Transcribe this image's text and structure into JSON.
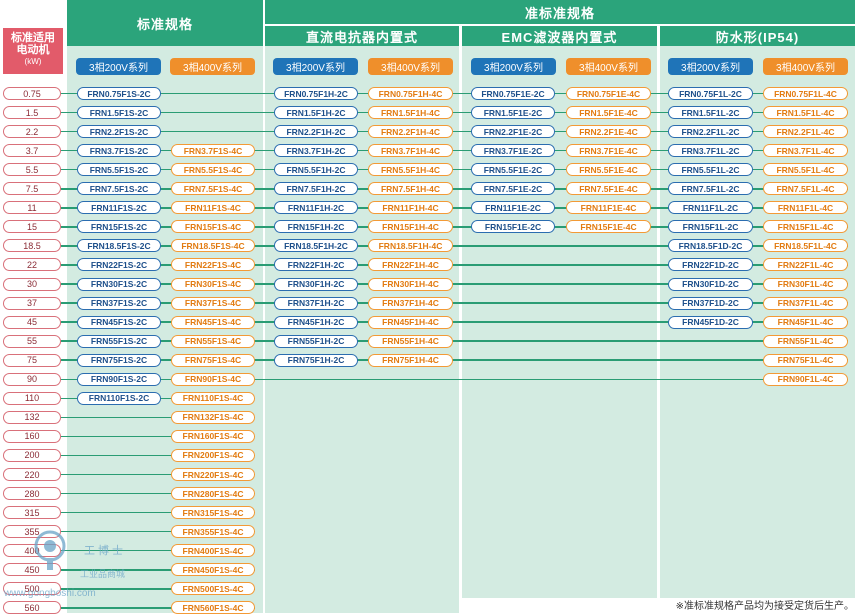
{
  "headers": {
    "standard": "标准规格",
    "semi_standard": "准标准规格",
    "dc_reactor": "直流电抗器内置式",
    "emc": "EMC滤波器内置式",
    "waterproof": "防水形(IP54)"
  },
  "side": {
    "line1": "标准适用",
    "line2": "电动机",
    "unit": "(kW)"
  },
  "series": {
    "v200": "3相200V系列",
    "v400": "3相400V系列"
  },
  "kw": [
    "0.75",
    "1.5",
    "2.2",
    "3.7",
    "5.5",
    "7.5",
    "11",
    "15",
    "18.5",
    "22",
    "30",
    "37",
    "45",
    "55",
    "75",
    "90",
    "110",
    "132",
    "160",
    "200",
    "220",
    "280",
    "315",
    "355",
    "400",
    "450",
    "500",
    "560"
  ],
  "columns": {
    "std200": [
      "FRN0.75F1S-2C",
      "FRN1.5F1S-2C",
      "FRN2.2F1S-2C",
      "FRN3.7F1S-2C",
      "FRN5.5F1S-2C",
      "FRN7.5F1S-2C",
      "FRN11F1S-2C",
      "FRN15F1S-2C",
      "FRN18.5F1S-2C",
      "FRN22F1S-2C",
      "FRN30F1S-2C",
      "FRN37F1S-2C",
      "FRN45F1S-2C",
      "FRN55F1S-2C",
      "FRN75F1S-2C",
      "FRN90F1S-2C",
      "FRN110F1S-2C"
    ],
    "std400": [
      "FRN3.7F1S-4C",
      "FRN5.5F1S-4C",
      "FRN7.5F1S-4C",
      "FRN11F1S-4C",
      "FRN15F1S-4C",
      "FRN18.5F1S-4C",
      "FRN22F1S-4C",
      "FRN30F1S-4C",
      "FRN37F1S-4C",
      "FRN45F1S-4C",
      "FRN55F1S-4C",
      "FRN75F1S-4C",
      "FRN90F1S-4C",
      "FRN110F1S-4C",
      "FRN132F1S-4C",
      "FRN160F1S-4C",
      "FRN200F1S-4C",
      "FRN220F1S-4C",
      "FRN280F1S-4C",
      "FRN315F1S-4C",
      "FRN355F1S-4C",
      "FRN400F1S-4C",
      "FRN450F1S-4C",
      "FRN500F1S-4C",
      "FRN560F1S-4C"
    ],
    "dc200": [
      "FRN0.75F1H-2C",
      "FRN1.5F1H-2C",
      "FRN2.2F1H-2C",
      "FRN3.7F1H-2C",
      "FRN5.5F1H-2C",
      "FRN7.5F1H-2C",
      "FRN11F1H-2C",
      "FRN15F1H-2C",
      "FRN18.5F1H-2C",
      "FRN22F1H-2C",
      "FRN30F1H-2C",
      "FRN37F1H-2C",
      "FRN45F1H-2C",
      "FRN55F1H-2C",
      "FRN75F1H-2C"
    ],
    "dc400": [
      "FRN0.75F1H-4C",
      "FRN1.5F1H-4C",
      "FRN2.2F1H-4C",
      "FRN3.7F1H-4C",
      "FRN5.5F1H-4C",
      "FRN7.5F1H-4C",
      "FRN11F1H-4C",
      "FRN15F1H-4C",
      "FRN18.5F1H-4C",
      "FRN22F1H-4C",
      "FRN30F1H-4C",
      "FRN37F1H-4C",
      "FRN45F1H-4C",
      "FRN55F1H-4C",
      "FRN75F1H-4C"
    ],
    "emc200": [
      "FRN0.75F1E-2C",
      "FRN1.5F1E-2C",
      "FRN2.2F1E-2C",
      "FRN3.7F1E-2C",
      "FRN5.5F1E-2C",
      "FRN7.5F1E-2C",
      "FRN11F1E-2C",
      "FRN15F1E-2C"
    ],
    "emc400": [
      "FRN0.75F1E-4C",
      "FRN1.5F1E-4C",
      "FRN2.2F1E-4C",
      "FRN3.7F1E-4C",
      "FRN5.5F1E-4C",
      "FRN7.5F1E-4C",
      "FRN11F1E-4C",
      "FRN15F1E-4C"
    ],
    "wp200": [
      "FRN0.75F1L-2C",
      "FRN1.5F1L-2C",
      "FRN2.2F1L-2C",
      "FRN3.7F1L-2C",
      "FRN5.5F1L-2C",
      "FRN7.5F1L-2C",
      "FRN11F1L-2C",
      "FRN15F1L-2C",
      "FRN18.5F1D-2C",
      "FRN22F1D-2C",
      "FRN30F1D-2C",
      "FRN37F1D-2C",
      "FRN45F1D-2C"
    ],
    "wp400": [
      "FRN0.75F1L-4C",
      "FRN1.5F1L-4C",
      "FRN2.2F1L-4C",
      "FRN3.7F1L-4C",
      "FRN5.5F1L-4C",
      "FRN7.5F1L-4C",
      "FRN11F1L-4C",
      "FRN15F1L-4C",
      "FRN18.5F1L-4C",
      "FRN22F1L-4C",
      "FRN30F1L-4C",
      "FRN37F1L-4C",
      "FRN45F1L-4C",
      "FRN55F1L-4C",
      "FRN75F1L-4C",
      "FRN90F1L-4C"
    ]
  },
  "column_start_rows": {
    "std200": 0,
    "std400": 3,
    "dc200": 0,
    "dc400": 0,
    "emc200": 0,
    "emc400": 0,
    "wp200": 0,
    "wp400": 0
  },
  "footnote": "※准标准规格产品均为接受定货后生产。",
  "watermark": {
    "brand": "工博士",
    "sub": "工业品商城",
    "url": "www.gongboshi.com"
  },
  "colors": {
    "header_green": "#2ba47b",
    "panel": "#d3ebe1",
    "blue": "#1f74b8",
    "orange": "#ef8f2b",
    "kw_red": "#e25b6a"
  }
}
